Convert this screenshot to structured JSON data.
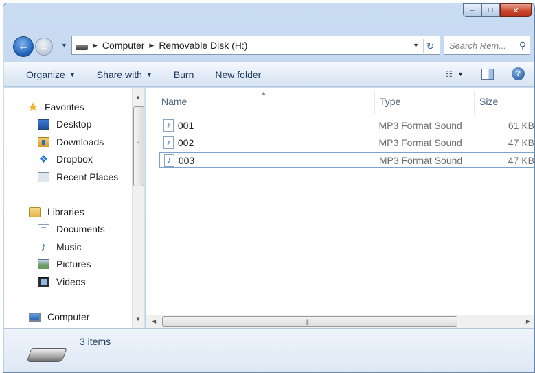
{
  "window": {
    "caption_buttons": {
      "minimize": "–",
      "maximize": "□",
      "close": "✕"
    }
  },
  "address_bar": {
    "breadcrumbs": [
      "Computer",
      "Removable Disk (H:)"
    ],
    "search_placeholder": "Search Rem..."
  },
  "command_bar": {
    "organize": "Organize",
    "share_with": "Share with",
    "burn": "Burn",
    "new_folder": "New folder"
  },
  "nav_pane": {
    "favorites": {
      "label": "Favorites",
      "items": [
        {
          "label": "Desktop",
          "icon": "desktop-icon"
        },
        {
          "label": "Downloads",
          "icon": "downloads-icon"
        },
        {
          "label": "Dropbox",
          "icon": "dropbox-icon"
        },
        {
          "label": "Recent Places",
          "icon": "recent-places-icon"
        }
      ]
    },
    "libraries": {
      "label": "Libraries",
      "items": [
        {
          "label": "Documents",
          "icon": "documents-icon"
        },
        {
          "label": "Music",
          "icon": "music-icon"
        },
        {
          "label": "Pictures",
          "icon": "pictures-icon"
        },
        {
          "label": "Videos",
          "icon": "videos-icon"
        }
      ]
    },
    "computer": {
      "label": "Computer"
    }
  },
  "file_list": {
    "columns": {
      "name": "Name",
      "type": "Type",
      "size": "Size"
    },
    "sorted_by": "Name",
    "rows": [
      {
        "name": "001",
        "type": "MP3 Format Sound",
        "size": "61 KB",
        "selected": false
      },
      {
        "name": "002",
        "type": "MP3 Format Sound",
        "size": "47 KB",
        "selected": false
      },
      {
        "name": "003",
        "type": "MP3 Format Sound",
        "size": "47 KB",
        "selected": true
      }
    ]
  },
  "details_pane": {
    "item_count": "3 items"
  },
  "colors": {
    "frame": "#c9dcf2",
    "command_bar": "#e3ecf7",
    "accent_blue": "#1c5fb8",
    "selection_border": "#7da2ce"
  }
}
